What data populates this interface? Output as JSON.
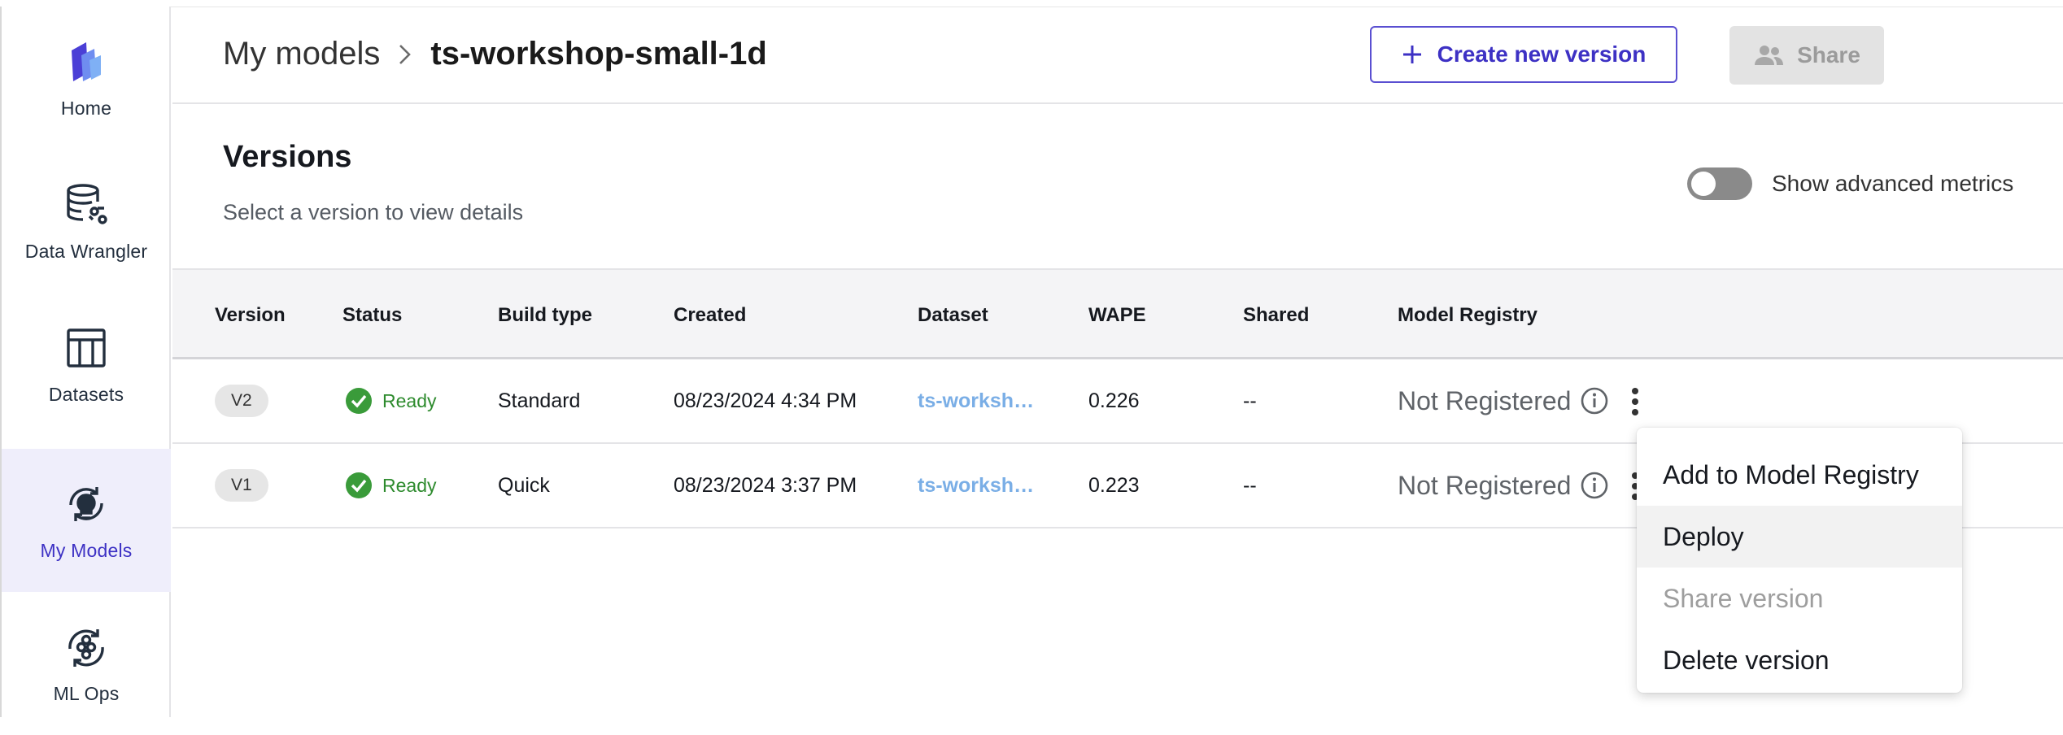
{
  "sidebar": {
    "items": [
      {
        "label": "Home"
      },
      {
        "label": "Data Wrangler"
      },
      {
        "label": "Datasets"
      },
      {
        "label": "My Models"
      },
      {
        "label": "ML Ops"
      }
    ],
    "active": "My Models"
  },
  "header": {
    "breadcrumb_parent": "My models",
    "breadcrumb_current": "ts-workshop-small-1d",
    "create_button": "Create new version",
    "share_button": "Share"
  },
  "versions": {
    "title": "Versions",
    "subtitle": "Select a version to view details",
    "toggle_label": "Show advanced metrics",
    "toggle_on": false
  },
  "table": {
    "columns": [
      "Version",
      "Status",
      "Build type",
      "Created",
      "Dataset",
      "WAPE",
      "Shared",
      "Model Registry"
    ],
    "rows": [
      {
        "version": "V2",
        "status": "Ready",
        "build_type": "Standard",
        "created": "08/23/2024 4:34 PM",
        "dataset": "ts-worksh…",
        "wape": "0.226",
        "shared": "--",
        "registry": "Not Registered"
      },
      {
        "version": "V1",
        "status": "Ready",
        "build_type": "Quick",
        "created": "08/23/2024 3:37 PM",
        "dataset": "ts-worksh…",
        "wape": "0.223",
        "shared": "--",
        "registry": "Not Registered"
      }
    ]
  },
  "menu": {
    "items": [
      {
        "label": "Add to Model Registry"
      },
      {
        "label": "Deploy"
      },
      {
        "label": "Share version"
      },
      {
        "label": "Delete version"
      }
    ]
  },
  "colors": {
    "accent": "#3d31c4",
    "ready": "#2e8b2e",
    "link": "#7aaee6",
    "active_nav_bg": "#efeefb"
  },
  "icons": [
    "home-logo-icon",
    "data-wrangler-icon",
    "datasets-icon",
    "my-models-icon",
    "ml-ops-icon",
    "chevron-right-icon",
    "plus-icon",
    "people-icon",
    "kebab-icon",
    "check-circle-icon",
    "info-icon"
  ]
}
